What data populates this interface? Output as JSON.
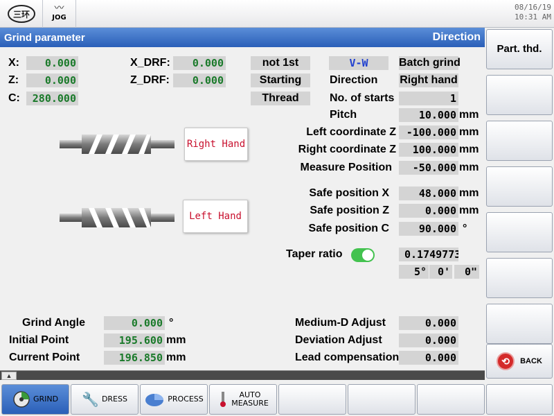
{
  "topbar": {
    "logo_text": "三环",
    "mode_label": "JOG",
    "date": "08/16/19",
    "time": "10:31 AM"
  },
  "panel": {
    "title": "Grind parameter",
    "mode": "Direction"
  },
  "axes": {
    "x_label": "X:",
    "x_value": "0.000",
    "z_label": "Z:",
    "z_value": "0.000",
    "c_label": "C:",
    "c_value": "280.000",
    "xdrf_label": "X_DRF:",
    "xdrf_value": "0.000",
    "zdrf_label": "Z_DRF:",
    "zdrf_value": "0.000"
  },
  "status": {
    "not_first": "not 1st",
    "starting": "Starting",
    "thread": "Thread",
    "vw": "V-W",
    "batch_grind": "Batch grind"
  },
  "params": {
    "direction_label": "Direction",
    "direction_value": "Right hand",
    "starts_label": "No. of starts",
    "starts_value": "1",
    "pitch_label": "Pitch",
    "pitch_value": "10.000",
    "pitch_unit": "mm",
    "left_coord_label": "Left coordinate Z",
    "left_coord_value": "-100.000",
    "left_coord_unit": "mm",
    "right_coord_label": "Right coordinate Z",
    "right_coord_value": "100.000",
    "right_coord_unit": "mm",
    "measure_label": "Measure Position",
    "measure_value": "-50.000",
    "measure_unit": "mm",
    "safe_x_label": "Safe position X",
    "safe_x_value": "48.000",
    "safe_x_unit": "mm",
    "safe_z_label": "Safe position Z",
    "safe_z_value": "0.000",
    "safe_z_unit": "mm",
    "safe_c_label": "Safe position C",
    "safe_c_value": "90.000",
    "safe_c_unit": "°",
    "taper_label": "Taper ratio",
    "taper_value": "0.1749773",
    "taper_deg": "5°",
    "taper_min": "0'",
    "taper_sec": "0\""
  },
  "callouts": {
    "right_hand": "Right Hand",
    "left_hand": "Left Hand"
  },
  "bottom_params": {
    "grind_angle_label": "Grind Angle",
    "grind_angle_value": "0.000",
    "grind_angle_unit": "°",
    "initial_label": "Initial Point",
    "initial_value": "195.600",
    "initial_unit": "mm",
    "current_label": "Current Point",
    "current_value": "196.850",
    "current_unit": "mm",
    "medium_label": "Medium-D Adjust",
    "medium_value": "0.000",
    "deviation_label": "Deviation Adjust",
    "deviation_value": "0.000",
    "lead_label": "Lead compensation",
    "lead_value": "0.000"
  },
  "sidekeys": {
    "part_thd": "Part. thd.",
    "back": "BACK"
  },
  "bottombar": {
    "grind": "GRIND",
    "dress": "DRESS",
    "process": "PROCESS",
    "auto_measure_1": "AUTO",
    "auto_measure_2": "MEASURE"
  },
  "colors": {
    "header_blue": "#2a5fb8",
    "value_green": "#1a7a2a",
    "accent_red": "#c8102e",
    "toggle_green": "#43c24f"
  }
}
